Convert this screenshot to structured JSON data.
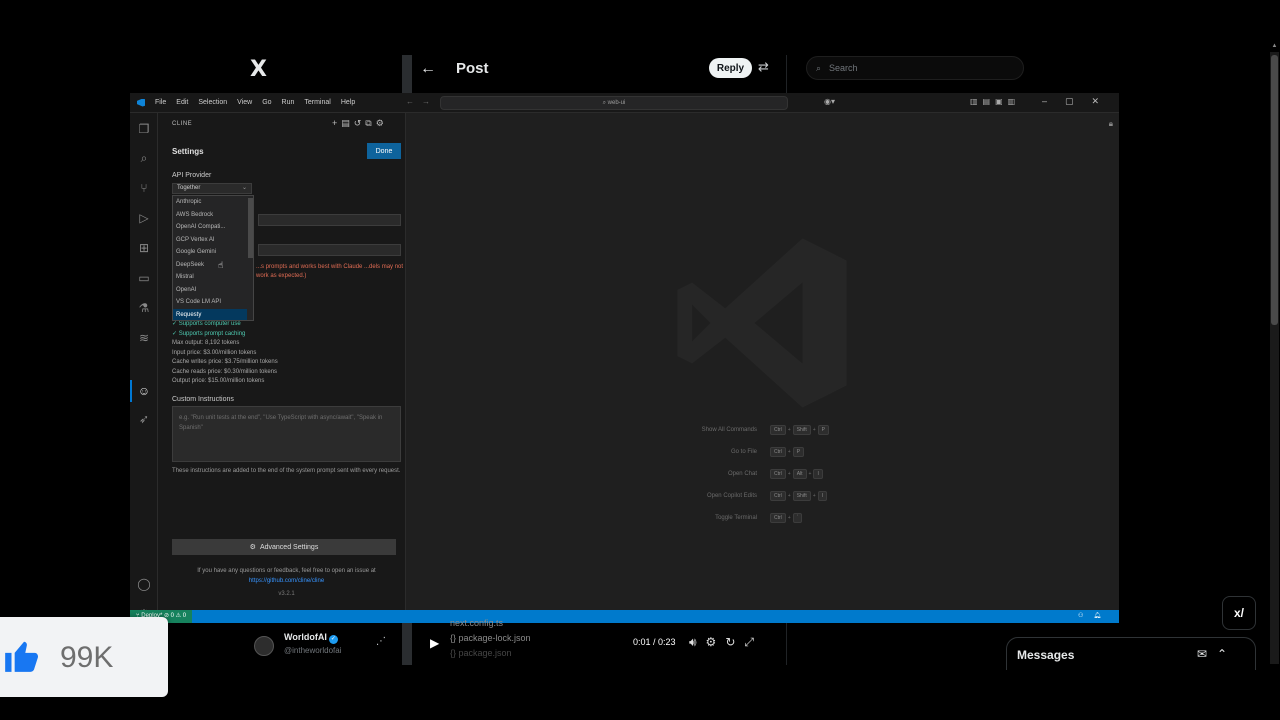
{
  "x": {
    "logo": "X",
    "post_title": "Post",
    "back": "←",
    "reply_label": "Reply",
    "search_placeholder": "Search",
    "messages_title": "Messages",
    "grok_label": "x/"
  },
  "vscode": {
    "menu": [
      "File",
      "Edit",
      "Selection",
      "View",
      "Go",
      "Run",
      "Terminal",
      "Help"
    ],
    "search_text": "⌕ web-ui",
    "sidebar": {
      "title": "CLINE",
      "settings_heading": "Settings",
      "done_label": "Done",
      "api_provider_label": "API Provider",
      "selected_provider": "Together",
      "providers": [
        "Anthropic",
        "AWS Bedrock",
        "OpenAI Compati...",
        "GCP Vertex AI",
        "Google Gemini",
        "DeepSeek",
        "Mistral",
        "OpenAI",
        "VS Code LM API",
        "Requesty"
      ],
      "warning": "...s prompts and works best with Claude ...dels may not work as expected.)",
      "model_info": {
        "supports_computer_use": "✓ Supports computer use",
        "supports_prompt_caching": "✓ Supports prompt caching",
        "max_output": "Max output: 8,192 tokens",
        "input_price": "Input price: $3.00/million tokens",
        "cache_writes_price": "Cache writes price: $3.75/million tokens",
        "cache_reads_price": "Cache reads price: $0.30/million tokens",
        "output_price": "Output price: $15.00/million tokens"
      },
      "custom_instructions_label": "Custom Instructions",
      "custom_instructions_placeholder": "e.g. \"Run unit tests at the end\", \"Use TypeScript with async/await\", \"Speak in Spanish\"",
      "custom_instructions_desc": "These instructions are added to the end of the system prompt sent with every request.",
      "advanced_settings_label": "Advanced Settings",
      "feedback_text": "If you have any questions or feedback, feel free to open an issue at",
      "feedback_link": "https://github.com/cline/cline",
      "version": "v3.2.1"
    },
    "shortcuts": [
      {
        "label": "Show All Commands",
        "keys": [
          "Ctrl",
          "Shift",
          "P"
        ]
      },
      {
        "label": "Go to File",
        "keys": [
          "Ctrl",
          "P"
        ]
      },
      {
        "label": "Open Chat",
        "keys": [
          "Ctrl",
          "Alt",
          "I"
        ]
      },
      {
        "label": "Open Copilot Edits",
        "keys": [
          "Ctrl",
          "Shift",
          "I"
        ]
      },
      {
        "label": "Toggle Terminal",
        "keys": [
          "Ctrl",
          "`"
        ]
      }
    ],
    "statusbar_left": "⑂ Deploy* ⊘ 0 ⚠ 0",
    "accent_color": "#007acc"
  },
  "tweet": {
    "author_name": "WorldofAI",
    "author_handle": "@intheworldofai"
  },
  "video": {
    "overlay_line1": "next.config.ts",
    "overlay_line2": "{} package-lock.json",
    "overlay_line3": "{} package.json",
    "time": "0:01 / 0:23"
  },
  "like_overlay": {
    "count": "99K"
  }
}
